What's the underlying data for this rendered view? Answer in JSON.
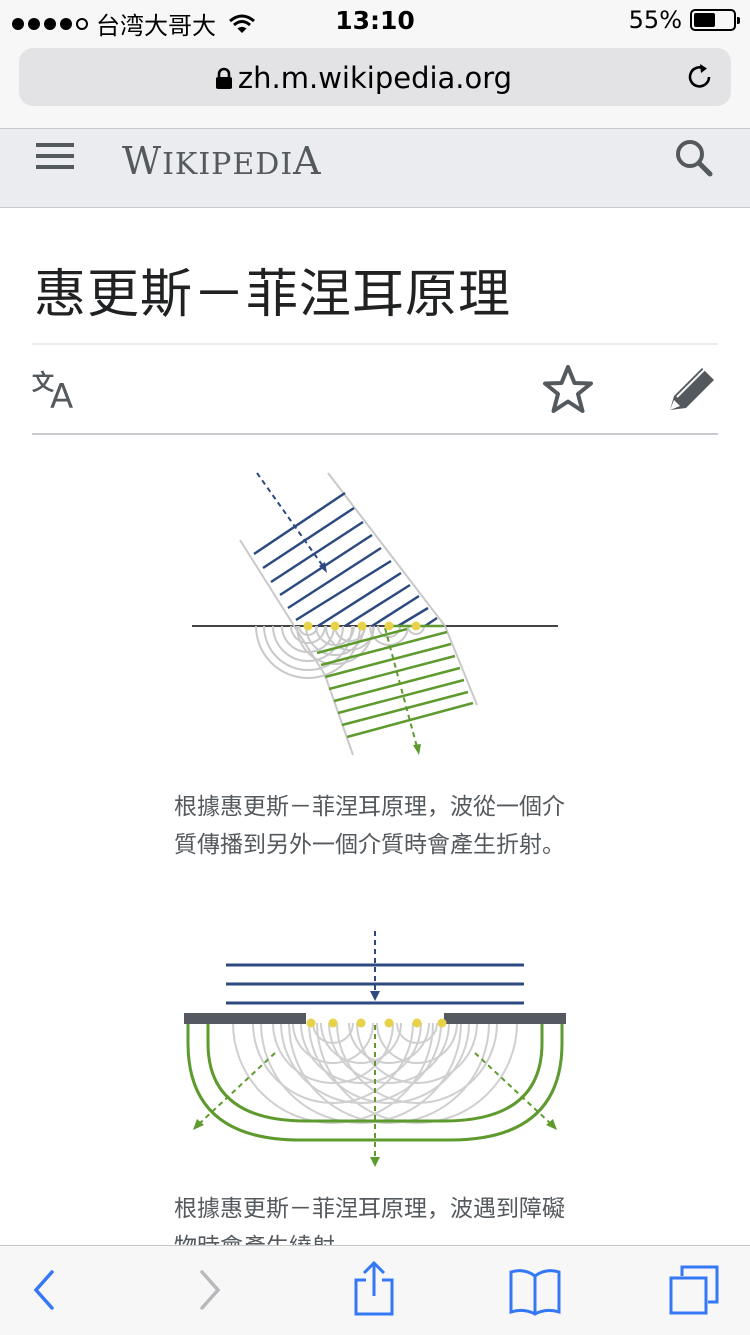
{
  "status_bar": {
    "carrier": "台湾大哥大",
    "time": "13:10",
    "battery_text": "55%",
    "battery_level": 0.55
  },
  "browser": {
    "url": "zh.m.wikipedia.org"
  },
  "header": {
    "logo_text": "Wikipedia"
  },
  "article": {
    "title": "惠更斯－菲涅耳原理",
    "figures": [
      {
        "caption": "根據惠更斯－菲涅耳原理，波從一個介質傳播到另外一個介質時會產生折射。"
      },
      {
        "caption": "根據惠更斯－菲涅耳原理，波遇到障礙物時會產生繞射。"
      }
    ]
  },
  "icons": {
    "menu": "hamburger-menu-icon",
    "search": "search-icon",
    "language": "translate-icon",
    "watch": "star-icon",
    "edit": "pencil-icon",
    "back": "chevron-left-icon",
    "forward": "chevron-right-icon",
    "share": "share-icon",
    "bookmarks": "book-icon",
    "tabs": "tabs-icon"
  },
  "colors": {
    "incident_wave": "#2c4a80",
    "refracted_wave": "#5e9a2e",
    "wavelet_point": "#e7d24a",
    "accent": "#3478f6"
  }
}
